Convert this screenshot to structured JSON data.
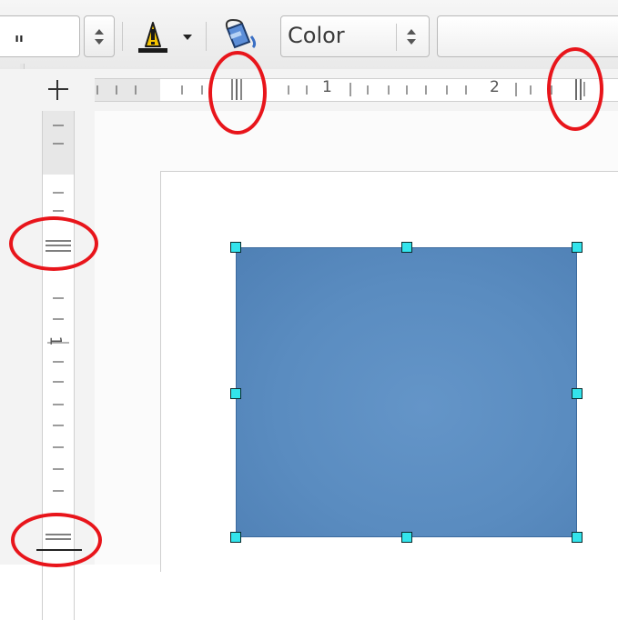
{
  "toolbar": {
    "line_width_value": "\"",
    "area_style_value": "Color",
    "icons": [
      "spinner-icon",
      "line-color-icon",
      "dropdown-arrow-icon",
      "paint-bucket-icon"
    ]
  },
  "ruler": {
    "h_numbers": [
      "1",
      "2"
    ],
    "v_numbers": [
      "1"
    ]
  },
  "colors": {
    "shape_fill": "#5a8cc0",
    "handle_fill": "#33e4ec",
    "annotation": "#e8151b"
  }
}
